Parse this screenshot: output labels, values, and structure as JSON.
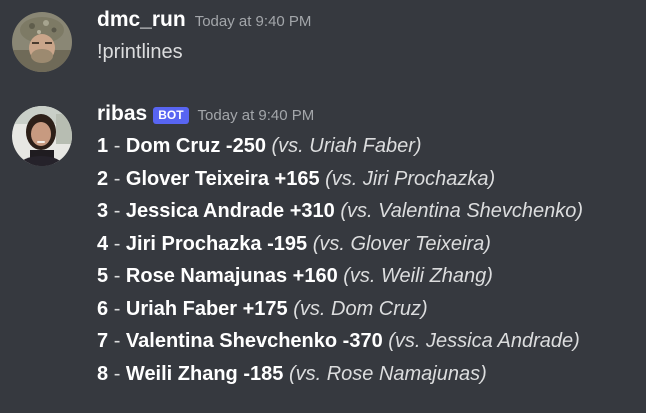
{
  "messages": [
    {
      "username": "dmc_run",
      "timestamp": "Today at 9:40 PM",
      "text": "!printlines"
    },
    {
      "username": "ribas",
      "bot_badge": "BOT",
      "timestamp": "Today at 9:40 PM",
      "lines": [
        {
          "num": "1",
          "sep": "-",
          "fighter": "Dom Cruz -250",
          "opponent": "(vs. Uriah Faber)"
        },
        {
          "num": "2",
          "sep": "-",
          "fighter": "Glover Teixeira +165",
          "opponent": "(vs. Jiri Prochazka)"
        },
        {
          "num": "3",
          "sep": "-",
          "fighter": "Jessica Andrade +310",
          "opponent": "(vs. Valentina Shevchenko)"
        },
        {
          "num": "4",
          "sep": "-",
          "fighter": "Jiri Prochazka -195",
          "opponent": "(vs. Glover Teixeira)"
        },
        {
          "num": "5",
          "sep": "-",
          "fighter": "Rose Namajunas +160",
          "opponent": "(vs. Weili Zhang)"
        },
        {
          "num": "6",
          "sep": "-",
          "fighter": "Uriah Faber +175",
          "opponent": "(vs. Dom Cruz)"
        },
        {
          "num": "7",
          "sep": "-",
          "fighter": "Valentina Shevchenko -370",
          "opponent": "(vs. Jessica Andrade)"
        },
        {
          "num": "8",
          "sep": "-",
          "fighter": "Weili Zhang -185",
          "opponent": "(vs. Rose Namajunas)"
        }
      ]
    }
  ],
  "colors": {
    "background": "#36393f",
    "username": "#ffffff",
    "timestamp": "#a3a6aa",
    "text": "#dcddde",
    "bot_badge": "#5865f2"
  }
}
